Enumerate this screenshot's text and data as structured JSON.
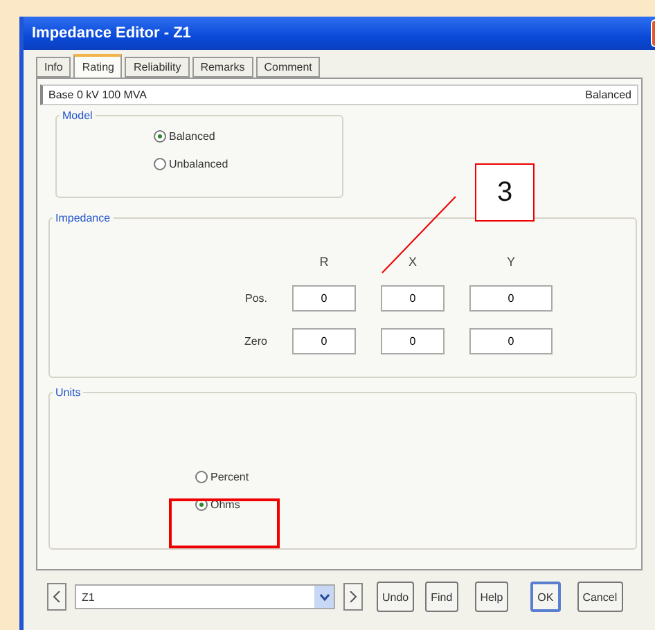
{
  "window": {
    "title": "Impedance Editor - Z1"
  },
  "tabs": [
    {
      "label": "Info",
      "selected": false
    },
    {
      "label": "Rating",
      "selected": true
    },
    {
      "label": "Reliability",
      "selected": false
    },
    {
      "label": "Remarks",
      "selected": false
    },
    {
      "label": "Comment",
      "selected": false
    }
  ],
  "header": {
    "base": "Base 0 kV 100 MVA",
    "mode": "Balanced"
  },
  "model": {
    "label": "Model",
    "options": [
      {
        "label": "Balanced",
        "selected": true
      },
      {
        "label": "Unbalanced",
        "selected": false
      }
    ]
  },
  "impedance": {
    "label": "Impedance",
    "columns": [
      "R",
      "X",
      "Y"
    ],
    "rows": [
      {
        "label": "Pos.",
        "values": [
          "0",
          "0",
          "0"
        ]
      },
      {
        "label": "Zero",
        "values": [
          "0",
          "0",
          "0"
        ]
      }
    ]
  },
  "units": {
    "label": "Units",
    "options": [
      {
        "label": "Percent",
        "selected": false
      },
      {
        "label": "Ohms",
        "selected": true
      }
    ]
  },
  "footer": {
    "selector": "Z1",
    "buttons": [
      {
        "label": "Undo",
        "default": false
      },
      {
        "label": "Find",
        "default": false
      },
      {
        "label": "Help",
        "default": false
      },
      {
        "label": "OK",
        "default": true
      },
      {
        "label": "Cancel",
        "default": false
      }
    ]
  },
  "callout": {
    "label": "3"
  }
}
